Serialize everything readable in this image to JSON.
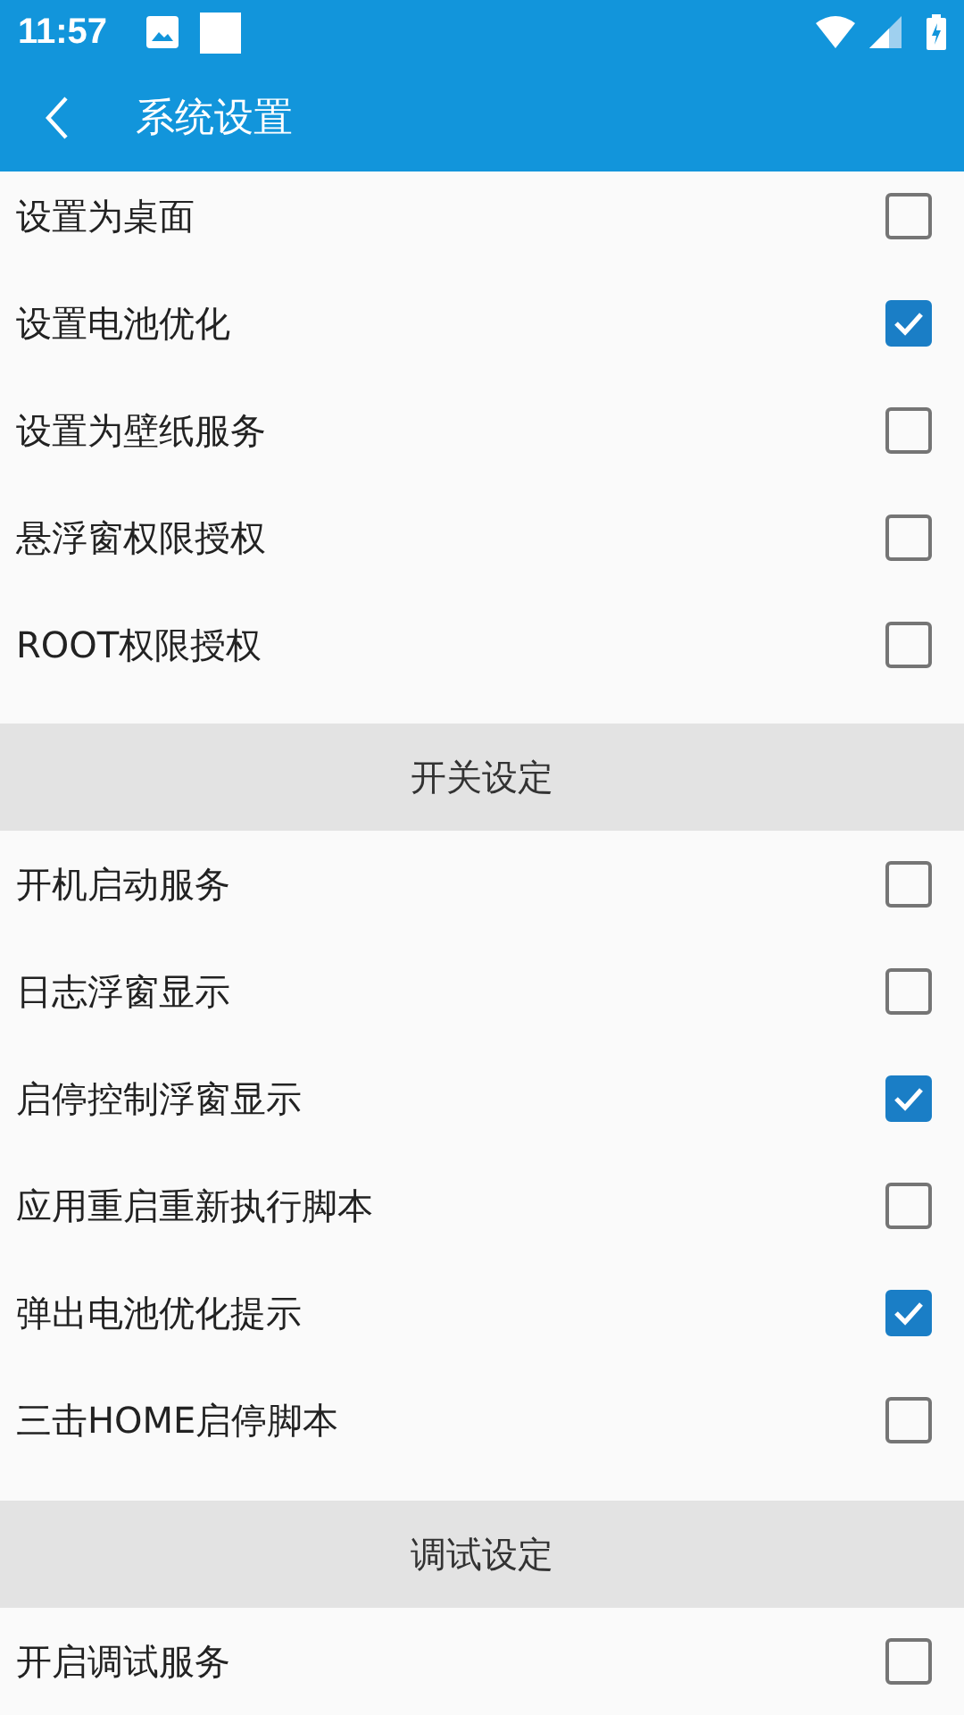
{
  "status_bar": {
    "time": "11:57"
  },
  "toolbar": {
    "title": "系统设置"
  },
  "sections": [
    {
      "items": [
        {
          "label": "设置为桌面",
          "checked": false
        },
        {
          "label": "设置电池优化",
          "checked": true
        },
        {
          "label": "设置为壁纸服务",
          "checked": false
        },
        {
          "label": "悬浮窗权限授权",
          "checked": false
        },
        {
          "label": "ROOT权限授权",
          "checked": false
        }
      ]
    },
    {
      "header": "开关设定",
      "items": [
        {
          "label": "开机启动服务",
          "checked": false
        },
        {
          "label": "日志浮窗显示",
          "checked": false
        },
        {
          "label": "启停控制浮窗显示",
          "checked": true
        },
        {
          "label": "应用重启重新执行脚本",
          "checked": false
        },
        {
          "label": "弹出电池优化提示",
          "checked": true
        },
        {
          "label": "三击HOME启停脚本",
          "checked": false
        }
      ]
    },
    {
      "header": "调试设定",
      "items": [
        {
          "label": "开启调试服务",
          "checked": false
        }
      ]
    }
  ]
}
